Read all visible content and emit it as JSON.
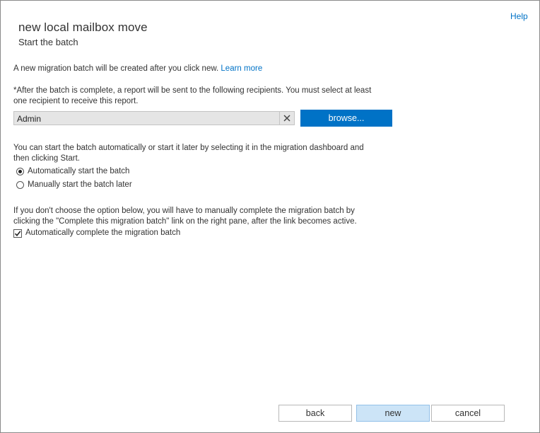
{
  "header": {
    "help_label": "Help",
    "title": "new local mailbox move",
    "subtitle": "Start the batch"
  },
  "intro": {
    "text": "A new migration batch will be created after you click new. ",
    "learn_more": "Learn more"
  },
  "recipients": {
    "instruction_line1": "*After the batch is complete, a report will be sent to the following recipients. You must select at least",
    "instruction_line2": "one recipient to receive this report.",
    "value": "Admin",
    "browse_label": "browse..."
  },
  "start": {
    "instruction_line1": "You can start the batch automatically or start it later by selecting it in the migration dashboard and",
    "instruction_line2": "then clicking Start.",
    "options": [
      {
        "label": "Automatically start the batch",
        "selected": true
      },
      {
        "label": "Manually start the batch later",
        "selected": false
      }
    ]
  },
  "complete": {
    "instruction_line1": "If you don't choose the option below, you will have to manually complete the migration batch by",
    "instruction_line2": "clicking the \"Complete this migration batch\" link on the right pane, after the link becomes active.",
    "checkbox_label": "Automatically complete the migration batch",
    "checked": true
  },
  "footer": {
    "back_label": "back",
    "new_label": "new",
    "cancel_label": "cancel"
  },
  "colors": {
    "accent": "#0072c6",
    "primary_button_bg": "#cce4f7",
    "input_bg": "#e5e5e5"
  }
}
